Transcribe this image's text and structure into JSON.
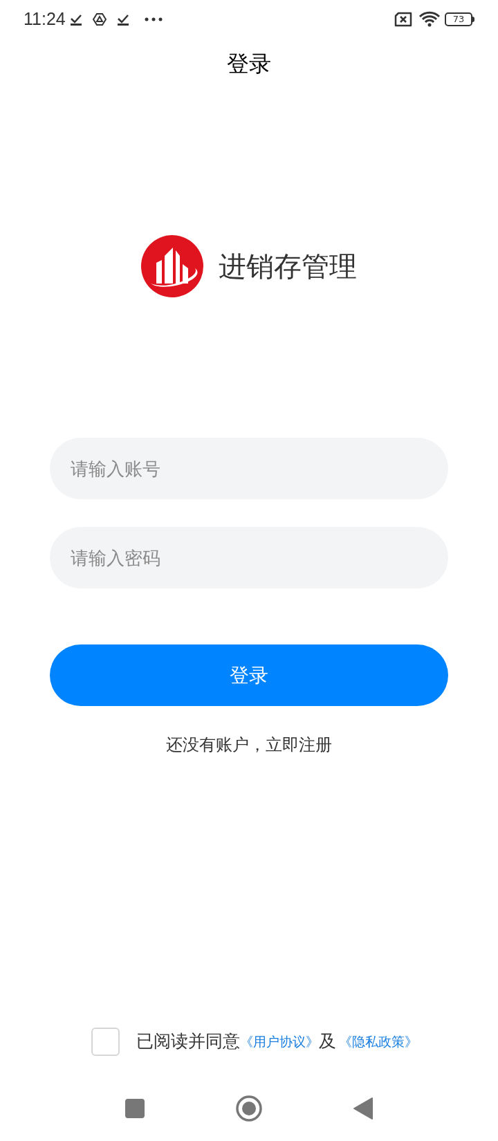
{
  "status_bar": {
    "time": "11:24",
    "battery": "73"
  },
  "title": "登录",
  "brand": {
    "name": "进销存管理"
  },
  "fields": [
    {
      "placeholder": "请输入账号"
    },
    {
      "placeholder": "请输入密码"
    }
  ],
  "login_button": "登录",
  "register_link": "还没有账户，立即注册",
  "agreement": {
    "checked": false,
    "text": "已阅读并同意",
    "user_agreement": "《用户协议》",
    "conjunction": "及",
    "privacy_policy": "《隐私政策》"
  }
}
